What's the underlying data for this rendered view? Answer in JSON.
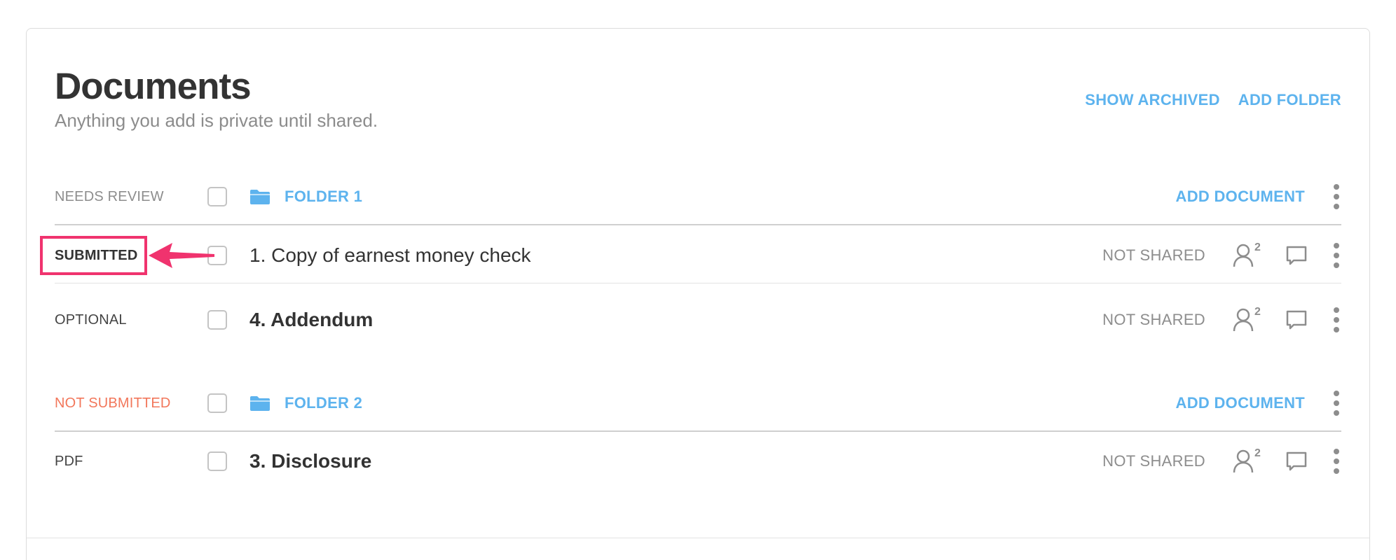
{
  "header": {
    "title": "Documents",
    "subtitle": "Anything you add is private until shared.",
    "show_archived": "SHOW ARCHIVED",
    "add_folder": "ADD FOLDER"
  },
  "folders": [
    {
      "status": "NEEDS REVIEW",
      "name": "FOLDER 1",
      "add_document": "ADD DOCUMENT",
      "documents": [
        {
          "status": "SUBMITTED",
          "title": "1. Copy of earnest money check",
          "shared": "NOT SHARED",
          "people_count": "2"
        },
        {
          "status": "OPTIONAL",
          "title": "4. Addendum",
          "shared": "NOT SHARED",
          "people_count": "2"
        }
      ]
    },
    {
      "status": "NOT SUBMITTED",
      "name": "FOLDER 2",
      "add_document": "ADD DOCUMENT",
      "documents": [
        {
          "status": "PDF",
          "title": "3. Disclosure",
          "shared": "NOT SHARED",
          "people_count": "2"
        }
      ]
    }
  ],
  "colors": {
    "accent": "#5db3ee",
    "highlight": "#f0336e",
    "not_submitted": "#f2775b"
  },
  "icons": {
    "folder": "folder-icon",
    "people": "people-icon",
    "comment": "comment-icon",
    "kebab": "kebab-menu-icon"
  }
}
